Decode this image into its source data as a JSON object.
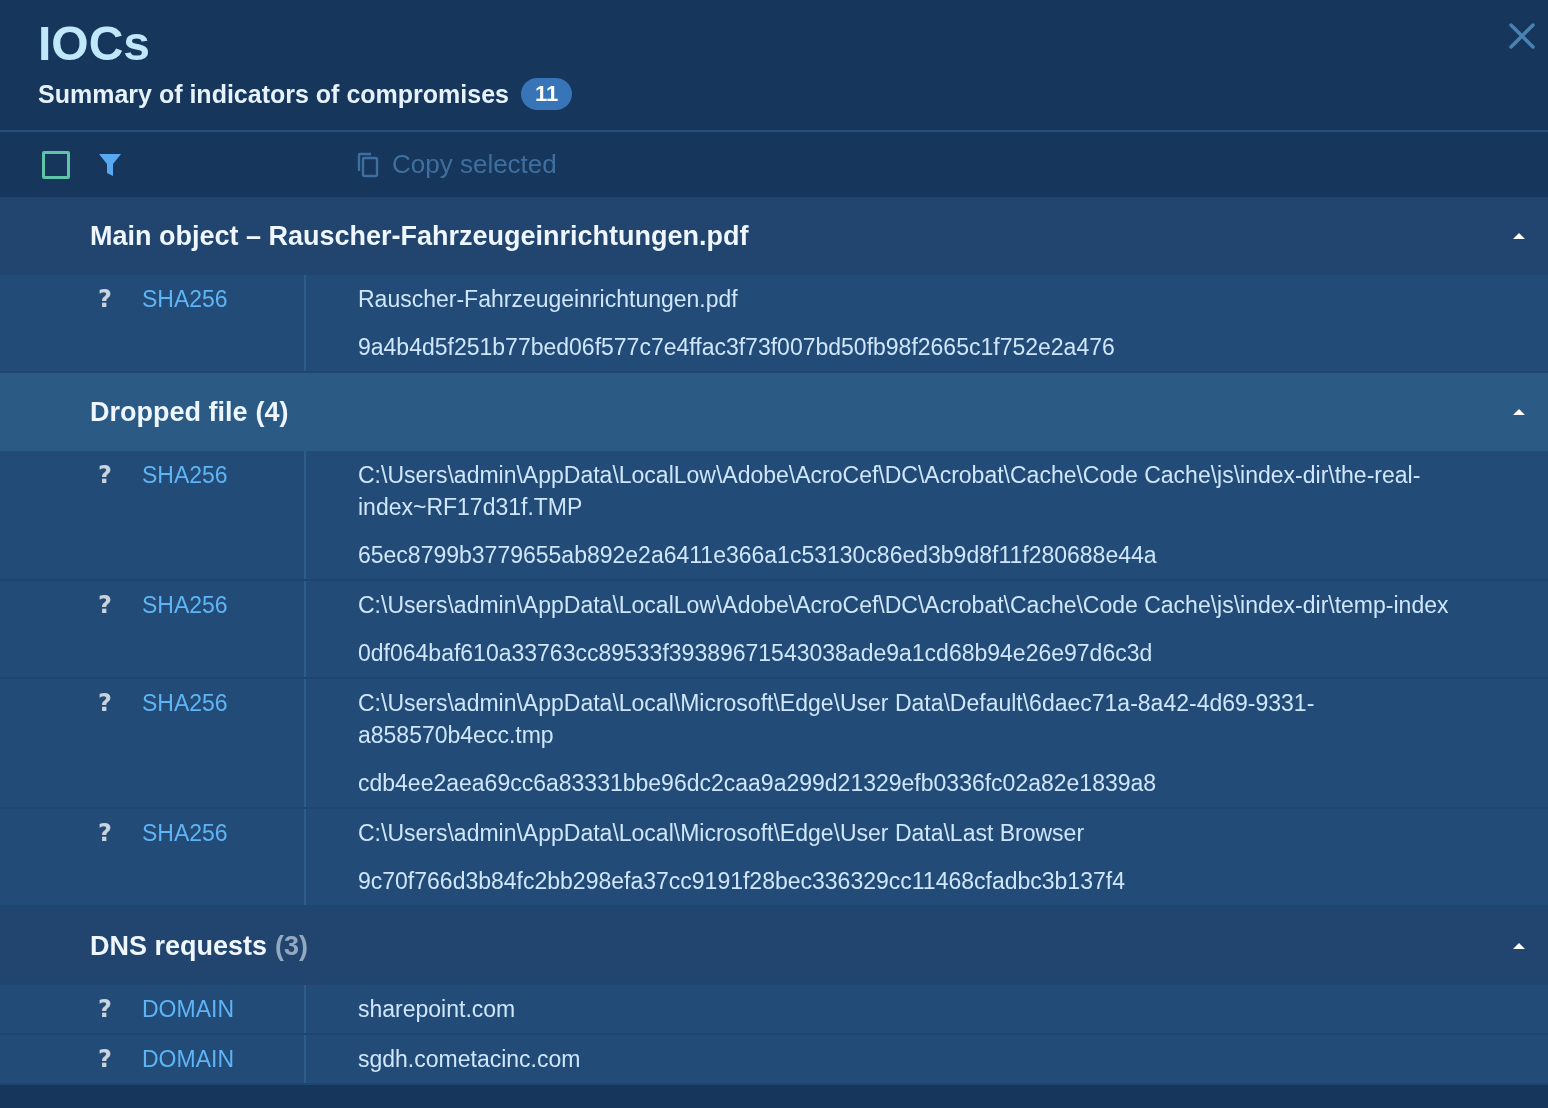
{
  "header": {
    "title": "IOCs",
    "subtitle": "Summary of indicators of compromises",
    "count": "11"
  },
  "toolbar": {
    "select_all_checked": false,
    "copy_label": "Copy selected",
    "copy_disabled": true
  },
  "sections": [
    {
      "title": "Main object – Rauscher-Fahrzeugeinrichtungen.pdf",
      "expanded": true,
      "highlighted": false,
      "rows": [
        {
          "help": "?",
          "type": "SHA256",
          "values": [
            "Rauscher-Fahrzeugeinrichtungen.pdf",
            "9a4b4d5f251b77bed06f577c7e4ffac3f73f007bd50fb98f2665c1f752e2a476"
          ]
        }
      ]
    },
    {
      "title": "Dropped file",
      "count": "(4)",
      "count_muted": false,
      "expanded": true,
      "highlighted": true,
      "rows": [
        {
          "help": "?",
          "type": "SHA256",
          "values": [
            "C:\\Users\\admin\\AppData\\LocalLow\\Adobe\\AcroCef\\DC\\Acrobat\\Cache\\Code Cache\\js\\index-dir\\the-real-index~RF17d31f.TMP",
            "65ec8799b3779655ab892e2a6411e366a1c53130c86ed3b9d8f11f280688e44a"
          ]
        },
        {
          "help": "?",
          "type": "SHA256",
          "values": [
            "C:\\Users\\admin\\AppData\\LocalLow\\Adobe\\AcroCef\\DC\\Acrobat\\Cache\\Code Cache\\js\\index-dir\\temp-index",
            "0df064baf610a33763cc89533f39389671543038ade9a1cd68b94e26e97d6c3d"
          ]
        },
        {
          "help": "?",
          "type": "SHA256",
          "values": [
            "C:\\Users\\admin\\AppData\\Local\\Microsoft\\Edge\\User Data\\Default\\6daec71a-8a42-4d69-9331-a858570b4ecc.tmp",
            "cdb4ee2aea69cc6a83331bbe96dc2caa9a299d21329efb0336fc02a82e1839a8"
          ]
        },
        {
          "help": "?",
          "type": "SHA256",
          "values": [
            "C:\\Users\\admin\\AppData\\Local\\Microsoft\\Edge\\User Data\\Last Browser",
            "9c70f766d3b84fc2bb298efa37cc9191f28bec336329cc11468cfadbc3b137f4"
          ]
        }
      ]
    },
    {
      "title": "DNS requests",
      "count": "(3)",
      "count_muted": true,
      "expanded": true,
      "highlighted": false,
      "rows": [
        {
          "help": "?",
          "type": "DOMAIN",
          "values": [
            "sharepoint.com"
          ]
        },
        {
          "help": "?",
          "type": "DOMAIN",
          "values": [
            "sgdh.cometacinc.com"
          ]
        }
      ]
    }
  ]
}
